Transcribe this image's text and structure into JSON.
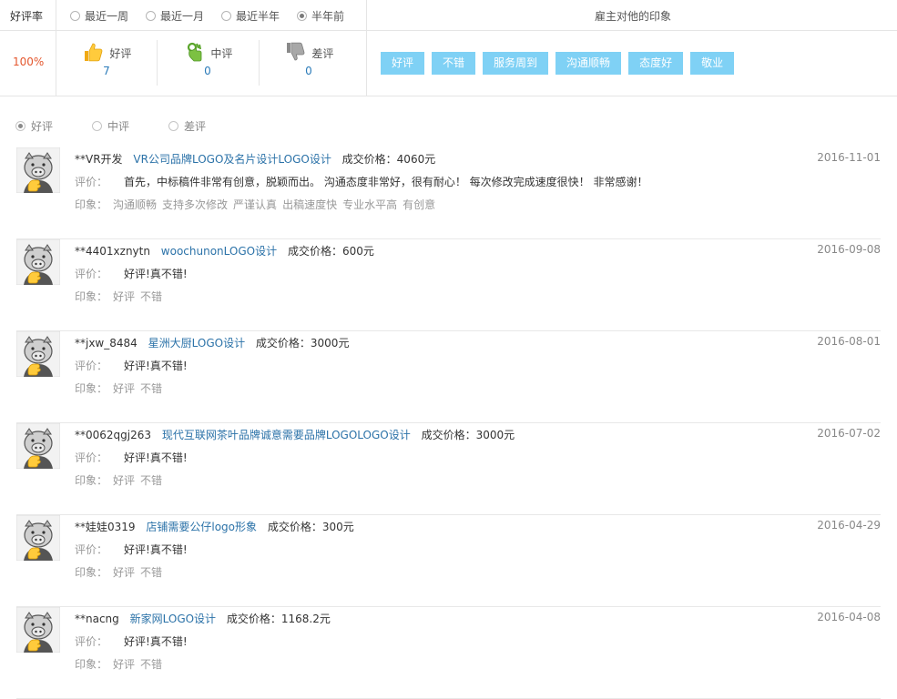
{
  "summary": {
    "rate_label": "好评率",
    "rate_value": "100%",
    "periods": [
      {
        "label": "最近一周",
        "selected": false
      },
      {
        "label": "最近一月",
        "selected": false
      },
      {
        "label": "最近半年",
        "selected": false
      },
      {
        "label": "半年前",
        "selected": true
      }
    ],
    "impression_title": "雇主对他的印象",
    "counts": [
      {
        "label": "好评",
        "value": "7",
        "icon": "thumb-up-icon"
      },
      {
        "label": "中评",
        "value": "0",
        "icon": "hand-ok-icon"
      },
      {
        "label": "差评",
        "value": "0",
        "icon": "thumb-down-icon"
      }
    ],
    "tags": [
      "好评",
      "不错",
      "服务周到",
      "沟通顺畅",
      "态度好",
      "敬业"
    ]
  },
  "filters": [
    {
      "label": "好评",
      "selected": true
    },
    {
      "label": "中评",
      "selected": false
    },
    {
      "label": "差评",
      "selected": false
    }
  ],
  "labels": {
    "comment": "评价：",
    "impression": "印象："
  },
  "reviews": [
    {
      "user": "**VR开发",
      "project": "VR公司品牌LOGO及名片设计LOGO设计",
      "price": "成交价格：4060元",
      "date": "2016-11-01",
      "comment": "首先，中标稿件非常有创意，脱颖而出。 沟通态度非常好，很有耐心！ 每次修改完成速度很快！ 非常感谢！",
      "tags": [
        "沟通顺畅",
        "支持多次修改",
        "严谨认真",
        "出稿速度快",
        "专业水平高",
        "有创意"
      ]
    },
    {
      "user": "**4401xznytn",
      "project": "woochunonLOGO设计",
      "price": "成交价格：600元",
      "date": "2016-09-08",
      "comment": "好评!真不错!",
      "tags": [
        "好评",
        "不错"
      ]
    },
    {
      "user": "**jxw_8484",
      "project": "星洲大厨LOGO设计",
      "price": "成交价格：3000元",
      "date": "2016-08-01",
      "comment": "好评!真不错!",
      "tags": [
        "好评",
        "不错"
      ]
    },
    {
      "user": "**0062qgj263",
      "project": "现代互联网茶叶品牌诚意需要品牌LOGOLOGO设计",
      "price": "成交价格：3000元",
      "date": "2016-07-02",
      "comment": "好评!真不错!",
      "tags": [
        "好评",
        "不错"
      ]
    },
    {
      "user": "**娃娃0319",
      "project": "店铺需要公仔logo形象",
      "price": "成交价格：300元",
      "date": "2016-04-29",
      "comment": "好评!真不错!",
      "tags": [
        "好评",
        "不错"
      ]
    },
    {
      "user": "**nacng",
      "project": "新家网LOGO设计",
      "price": "成交价格：1168.2元",
      "date": "2016-04-08",
      "comment": "好评!真不错!",
      "tags": [
        "好评",
        "不错"
      ]
    }
  ],
  "colors": {
    "accent_link": "#2b72a8",
    "tag_bg": "#7fd1f5",
    "rate": "#e4572e"
  }
}
